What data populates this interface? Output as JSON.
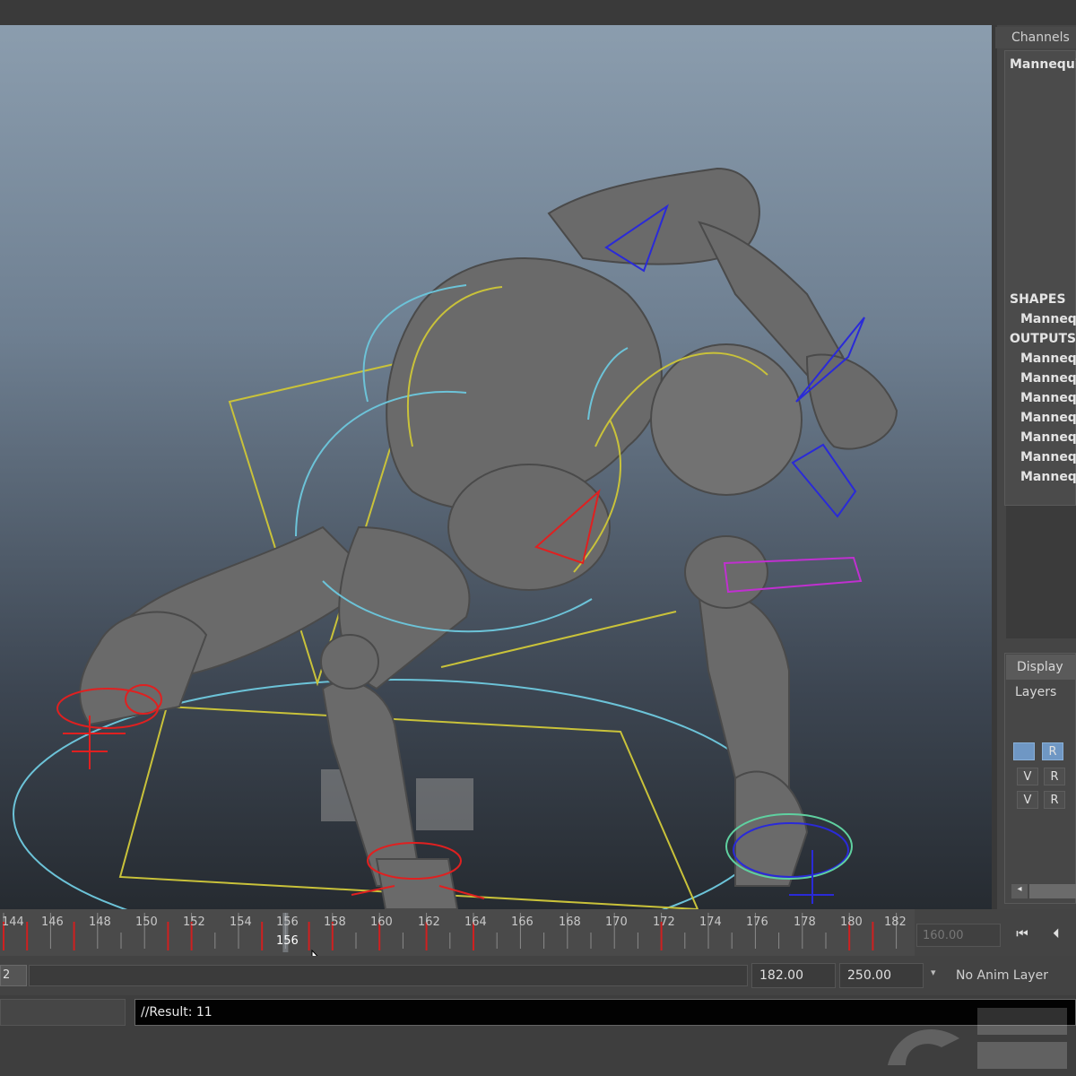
{
  "channel_box": {
    "header": "Channels",
    "object_name": "Mannequi",
    "shapes_label": "SHAPES",
    "shapes": [
      "Manneq"
    ],
    "outputs_label": "OUTPUTS",
    "outputs": [
      "Manneq",
      "Manneq",
      "Manneq",
      "Manneq",
      "Manneq",
      "Manneq",
      "Manneq"
    ]
  },
  "layer_editor": {
    "tab": "Display",
    "menu": "Layers",
    "rows": [
      {
        "v": "",
        "r": "R"
      },
      {
        "v": "V",
        "r": "R"
      },
      {
        "v": "V",
        "r": "R"
      }
    ]
  },
  "timeline": {
    "ticks": [
      "144",
      "146",
      "148",
      "150",
      "152",
      "154",
      "156",
      "158",
      "160",
      "162",
      "164",
      "166",
      "168",
      "170",
      "172",
      "174",
      "176",
      "178",
      "180",
      "182"
    ],
    "current_frame": "156",
    "end_field": "160.00"
  },
  "range_slider": {
    "start_field": "2",
    "playback_end": "182.00",
    "anim_end": "250.00",
    "anim_layer": "No Anim Layer"
  },
  "playback": {
    "go_to_start_icon": "step-to-start-icon",
    "step_back_icon": "step-back-icon"
  },
  "command_line": {
    "result": "//Result: 11"
  },
  "colors": {
    "selection_yellow": "#c9c23a",
    "cyan": "#6cc3d8",
    "ik_red": "#e02020",
    "ik_blue": "#2a2ad8",
    "magenta": "#c030d0",
    "keyframe": "#d02020"
  }
}
